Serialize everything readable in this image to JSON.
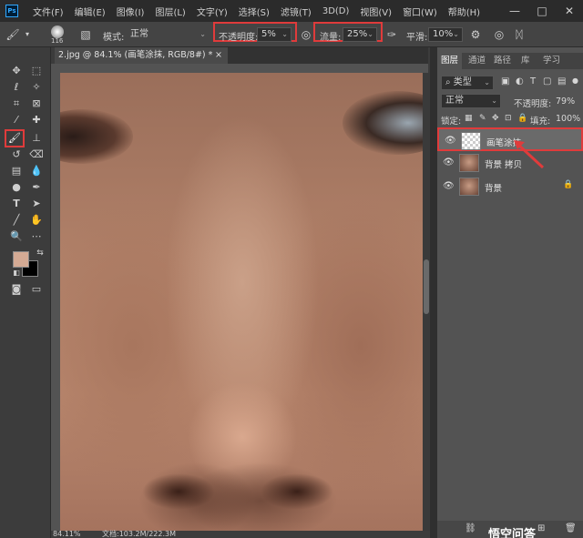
{
  "menubar": {
    "logo": "Ps",
    "items": [
      "文件(F)",
      "编辑(E)",
      "图像(I)",
      "图层(L)",
      "文字(Y)",
      "选择(S)",
      "滤镜(T)",
      "3D(D)",
      "视图(V)",
      "窗口(W)",
      "帮助(H)"
    ],
    "window_controls": [
      "—",
      "□",
      "✕"
    ]
  },
  "options": {
    "brush_size": "116",
    "mode_label": "模式:",
    "mode_value": "正常",
    "opacity_label": "不透明度:",
    "opacity_value": "5%",
    "flow_label": "流量:",
    "flow_value": "25%",
    "smooth_label": "平滑:",
    "smooth_value": "10%"
  },
  "document": {
    "tab_title": "2.jpg @ 84.1% (画笔涂抹, RGB/8#) *",
    "tab_close": "×",
    "zoom": "84.11%",
    "doc_size": "文档:103.2M/222.3M"
  },
  "colors": {
    "foreground": "#d4aa94",
    "background": "#000000",
    "accent_red": "#e03b3b"
  },
  "panel": {
    "tabs": [
      "图层",
      "通道",
      "路径",
      "库",
      "学习"
    ],
    "filter_label": "类型",
    "blend_mode": "正常",
    "opacity_label": "不透明度:",
    "opacity_value": "79%",
    "lock_label": "锁定:",
    "fill_label": "填充:",
    "fill_value": "100%",
    "layers": [
      {
        "name": "画笔涂抹",
        "selected": true
      },
      {
        "name": "背景 拷贝",
        "selected": false
      },
      {
        "name": "背景",
        "selected": false
      }
    ],
    "lock_icon": "🔒"
  },
  "watermark": "悟空问答"
}
